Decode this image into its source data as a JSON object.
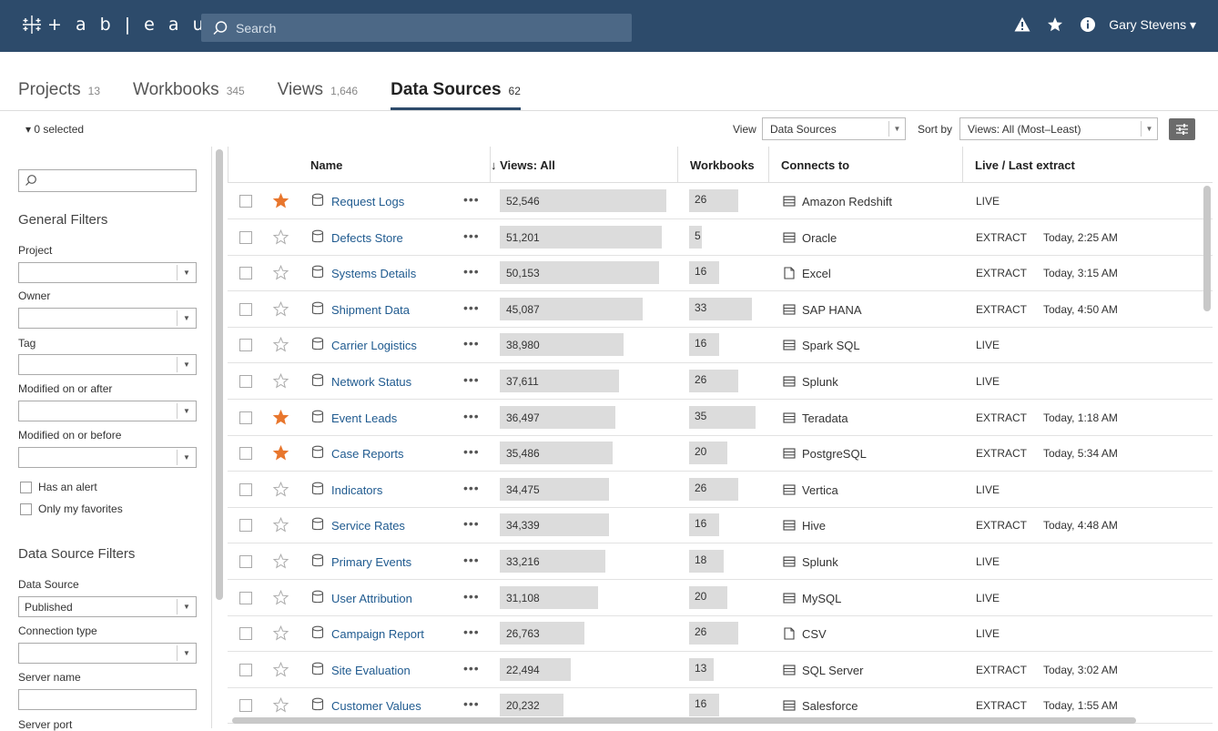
{
  "app": {
    "logo_text": "+ a b | e a u"
  },
  "search": {
    "placeholder": "Search"
  },
  "user": {
    "name": "Gary Stevens ▾"
  },
  "tabs": [
    {
      "label": "Projects",
      "count": "13",
      "active": false
    },
    {
      "label": "Workbooks",
      "count": "345",
      "active": false
    },
    {
      "label": "Views",
      "count": "1,646",
      "active": false
    },
    {
      "label": "Data Sources",
      "count": "62",
      "active": true
    }
  ],
  "toolbar": {
    "selected": "▾ 0 selected",
    "view_label": "View",
    "view_value": "Data Sources",
    "sort_label": "Sort by",
    "sort_value": "Views: All (Most–Least)"
  },
  "sidebar": {
    "general_title": "General Filters",
    "project_label": "Project",
    "owner_label": "Owner",
    "tag_label": "Tag",
    "modified_after_label": "Modified on or after",
    "modified_before_label": "Modified on or before",
    "has_alert_label": "Has an alert",
    "favorites_label": "Only my favorites",
    "ds_title": "Data Source Filters",
    "data_source_label": "Data Source",
    "data_source_value": "Published",
    "connection_type_label": "Connection type",
    "server_name_label": "Server name",
    "server_port_label": "Server port"
  },
  "table": {
    "headers": {
      "name": "Name",
      "views": "↓ Views: All",
      "workbooks": "Workbooks",
      "connects": "Connects to",
      "live": "Live / Last extract"
    },
    "max_views": 52546,
    "max_workbooks": 35,
    "rows": [
      {
        "name": "Request Logs",
        "views": "52,546",
        "views_n": 52546,
        "workbooks": "26",
        "workbooks_n": 26,
        "connects": "Amazon Redshift",
        "conn_icon": "table-icon",
        "live": "LIVE",
        "time": "",
        "fav": true
      },
      {
        "name": "Defects Store",
        "views": "51,201",
        "views_n": 51201,
        "workbooks": "5",
        "workbooks_n": 5,
        "connects": "Oracle",
        "conn_icon": "table-icon",
        "live": "EXTRACT",
        "time": "Today, 2:25 AM",
        "fav": false
      },
      {
        "name": "Systems Details",
        "views": "50,153",
        "views_n": 50153,
        "workbooks": "16",
        "workbooks_n": 16,
        "connects": "Excel",
        "conn_icon": "file-icon",
        "live": "EXTRACT",
        "time": "Today, 3:15 AM",
        "fav": false
      },
      {
        "name": "Shipment Data",
        "views": "45,087",
        "views_n": 45087,
        "workbooks": "33",
        "workbooks_n": 33,
        "connects": "SAP HANA",
        "conn_icon": "table-icon",
        "live": "EXTRACT",
        "time": "Today, 4:50 AM",
        "fav": false
      },
      {
        "name": "Carrier Logistics",
        "views": "38,980",
        "views_n": 38980,
        "workbooks": "16",
        "workbooks_n": 16,
        "connects": "Spark SQL",
        "conn_icon": "table-icon",
        "live": "LIVE",
        "time": "",
        "fav": false
      },
      {
        "name": "Network Status",
        "views": "37,611",
        "views_n": 37611,
        "workbooks": "26",
        "workbooks_n": 26,
        "connects": "Splunk",
        "conn_icon": "table-icon",
        "live": "LIVE",
        "time": "",
        "fav": false
      },
      {
        "name": "Event Leads",
        "views": "36,497",
        "views_n": 36497,
        "workbooks": "35",
        "workbooks_n": 35,
        "connects": "Teradata",
        "conn_icon": "table-icon",
        "live": "EXTRACT",
        "time": "Today, 1:18 AM",
        "fav": true
      },
      {
        "name": "Case Reports",
        "views": "35,486",
        "views_n": 35486,
        "workbooks": "20",
        "workbooks_n": 20,
        "connects": "PostgreSQL",
        "conn_icon": "table-icon",
        "live": "EXTRACT",
        "time": "Today, 5:34 AM",
        "fav": true
      },
      {
        "name": "Indicators",
        "views": "34,475",
        "views_n": 34475,
        "workbooks": "26",
        "workbooks_n": 26,
        "connects": "Vertica",
        "conn_icon": "table-icon",
        "live": "LIVE",
        "time": "",
        "fav": false
      },
      {
        "name": "Service Rates",
        "views": "34,339",
        "views_n": 34339,
        "workbooks": "16",
        "workbooks_n": 16,
        "connects": "Hive",
        "conn_icon": "table-icon",
        "live": "EXTRACT",
        "time": "Today, 4:48 AM",
        "fav": false
      },
      {
        "name": "Primary Events",
        "views": "33,216",
        "views_n": 33216,
        "workbooks": "18",
        "workbooks_n": 18,
        "connects": "Splunk",
        "conn_icon": "table-icon",
        "live": "LIVE",
        "time": "",
        "fav": false
      },
      {
        "name": "User Attribution",
        "views": "31,108",
        "views_n": 31108,
        "workbooks": "20",
        "workbooks_n": 20,
        "connects": "MySQL",
        "conn_icon": "table-icon",
        "live": "LIVE",
        "time": "",
        "fav": false
      },
      {
        "name": "Campaign Report",
        "views": "26,763",
        "views_n": 26763,
        "workbooks": "26",
        "workbooks_n": 26,
        "connects": "CSV",
        "conn_icon": "file-icon",
        "live": "LIVE",
        "time": "",
        "fav": false
      },
      {
        "name": "Site Evaluation",
        "views": "22,494",
        "views_n": 22494,
        "workbooks": "13",
        "workbooks_n": 13,
        "connects": "SQL Server",
        "conn_icon": "table-icon",
        "live": "EXTRACT",
        "time": "Today, 3:02 AM",
        "fav": false
      },
      {
        "name": "Customer Values",
        "views": "20,232",
        "views_n": 20232,
        "workbooks": "16",
        "workbooks_n": 16,
        "connects": "Salesforce",
        "conn_icon": "table-icon",
        "live": "EXTRACT",
        "time": "Today, 1:55 AM",
        "fav": false
      }
    ]
  },
  "colors": {
    "header_bg": "#2d4b6b",
    "link": "#1f5a8f",
    "star_fav": "#e8762d",
    "bar": "#dcdcdc"
  }
}
